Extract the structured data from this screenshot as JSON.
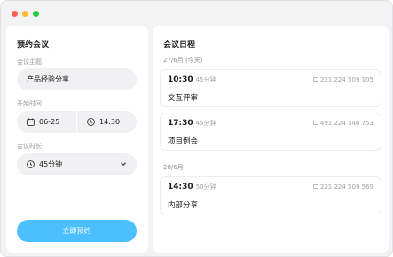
{
  "window": {
    "controls": [
      "close",
      "minimize",
      "maximize"
    ]
  },
  "booking": {
    "title": "预约会议",
    "topic_label": "会议主题",
    "topic_value": "产品经验分享",
    "time_label": "开始时间",
    "date_value": "06-25",
    "time_value": "14:30",
    "duration_label": "会议时长",
    "duration_value": "45分钟",
    "submit_label": "立即预约"
  },
  "schedule": {
    "title": "会议日程",
    "days": [
      {
        "label": "27/6月 (今天)",
        "meetings": [
          {
            "time": "10:30",
            "duration": "45分钟",
            "meeting_id": "221 224 509 105",
            "name": "交互评审"
          },
          {
            "time": "17:30",
            "duration": "45分钟",
            "meeting_id": "491 224 346 753",
            "name": "项目例会"
          }
        ]
      },
      {
        "label": "28/6月",
        "meetings": [
          {
            "time": "14:30",
            "duration": "50分钟",
            "meeting_id": "221 224 509 569",
            "name": "内部分享"
          }
        ]
      }
    ]
  },
  "colors": {
    "accent": "#4cc0ff",
    "close": "#fe5f57",
    "minimize": "#febc2e",
    "maximize": "#28c840"
  }
}
